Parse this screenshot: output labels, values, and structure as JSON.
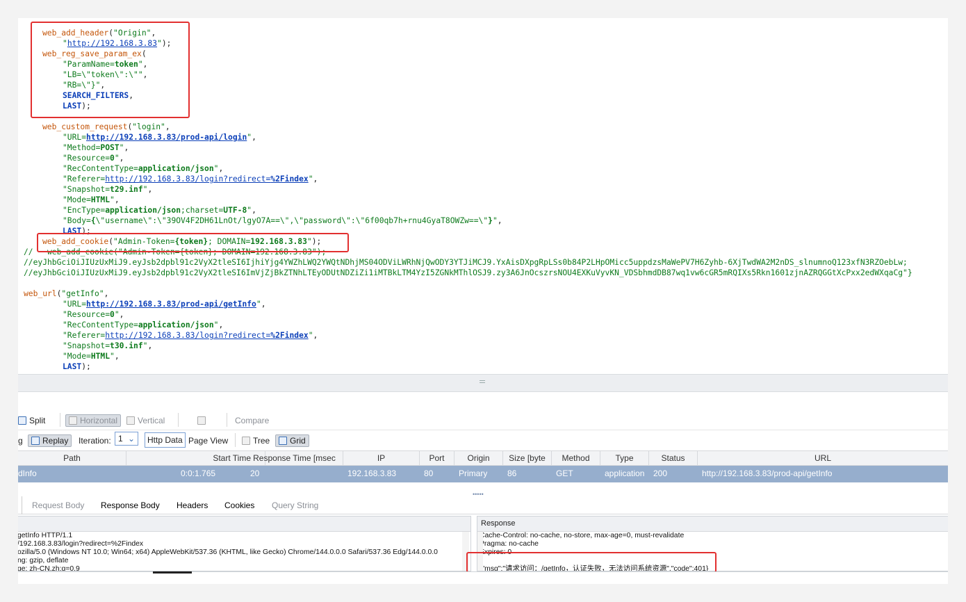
{
  "code_lines": [
    {
      "indent": "i1",
      "html": "<span class='fn'>web_add_header</span>(<span class='str'>\"Origin\"</span>,"
    },
    {
      "indent": "i2",
      "html": "<span class='str'>\"</span><span class='urlp'>http://192.168.3.83</span><span class='str'>\"</span>);"
    },
    {
      "indent": "i1",
      "html": "<span class='fn'>web_reg_save_param_ex</span>("
    },
    {
      "indent": "i2",
      "html": "<span class='str'>\"ParamName=</span><span class='grn'>token</span><span class='str'>\"</span>,"
    },
    {
      "indent": "i2",
      "html": "<span class='str'>\"LB=\\\"token\\\":\\\"\"</span>,"
    },
    {
      "indent": "i2",
      "html": "<span class='str'>\"RB=\\\"}\"</span>,"
    },
    {
      "indent": "i2",
      "html": "<span class='kw'>SEARCH_FILTERS</span>,"
    },
    {
      "indent": "i2",
      "html": "<span class='kw'>LAST</span>);"
    },
    {
      "indent": "i1",
      "html": ""
    },
    {
      "indent": "i1",
      "html": "<span class='fn'>web_custom_request</span>(<span class='str'>\"login\"</span>,"
    },
    {
      "indent": "i2",
      "html": "<span class='str'>\"URL=</span><span class='url'>http://192.168.3.83/prod-api/login</span><span class='str'>\"</span>,"
    },
    {
      "indent": "i2",
      "html": "<span class='str'>\"Method=</span><span class='grn'>POST</span><span class='str'>\"</span>,"
    },
    {
      "indent": "i2",
      "html": "<span class='str'>\"Resource=</span><span class='grn'>0</span><span class='str'>\"</span>,"
    },
    {
      "indent": "i2",
      "html": "<span class='str'>\"RecContentType=</span><span class='grn'>application/json</span><span class='str'>\"</span>,"
    },
    {
      "indent": "i2",
      "html": "<span class='str'>\"Referer=</span><span class='urlp'>http://192.168.3.83/login?redirect=</span><span class='url'>%2Findex</span><span class='str'>\"</span>,"
    },
    {
      "indent": "i2",
      "html": "<span class='str'>\"Snapshot=</span><span class='grn'>t29.inf</span><span class='str'>\"</span>,"
    },
    {
      "indent": "i2",
      "html": "<span class='str'>\"Mode=</span><span class='grn'>HTML</span><span class='str'>\"</span>,"
    },
    {
      "indent": "i2",
      "html": "<span class='str'>\"EncType=</span><span class='grn'>application/json</span><span class='str'>;charset=</span><span class='grn'>UTF-8</span><span class='str'>\"</span>,"
    },
    {
      "indent": "i2",
      "html": "<span class='str'>\"Body=</span><span class='grn'>{</span><span class='str'>\\\"username\\\":\\\"39OV4F2DH61LnOt/lgyO7A==\\\",\\\"password\\\":\\\"6f00qb7h+rnu4GyaT8OWZw==\\\"</span><span class='grn'>}</span><span class='str'>\"</span>,"
    },
    {
      "indent": "i2",
      "html": "<span class='kw'>LAST</span>);"
    },
    {
      "indent": "i1",
      "html": "<span class='fn'>web_add_cookie</span>(<span class='str'>\"Admin-Token=</span><span class='grn'>{token}</span><span class='str'>; DOMAIN=</span><span class='grn'>192.168.3.83</span><span class='str'>\"</span>);"
    },
    {
      "indent": "i0",
      "html": "<span class='cmt'>//   web_add_cookie(\"Admin-Token={token}; DOMAIN=192.168.3.83\");</span>"
    },
    {
      "indent": "i0",
      "html": "<span class='cmt'>//eyJhbGciOiJIUzUxMiJ9.eyJsb2dpbl91c2VyX2tleSI6IjhiYjg4YWZhLWQ2YWQtNDhjMS04ODViLWRhNjQwODY3YTJiMCJ9.YxAisDXpgRpLSs0b84P2LHpOMicc5uppdzsMaWePV7H6Zyhb-6XjTwdWA2M2nDS_slnumnoQ123xfN3RZOebLw;</span>"
    },
    {
      "indent": "i0",
      "html": "<span class='cmt'>//eyJhbGciOiJIUzUxMiJ9.eyJsb2dpbl91c2VyX2tleSI6ImVjZjBkZTNhLTEyODUtNDZiZi1iMTBkLTM4YzI5ZGNkMThlOSJ9.zy3A6JnOcszrsNOU4EXKuVyvKN_VDSbhmdDB87wq1vw6cGR5mRQIXs5Rkn1601zjnAZRQGGtXcPxx2edWXqaCg\"}</span>"
    },
    {
      "indent": "i0",
      "html": ""
    },
    {
      "indent": "i0",
      "html": "<span class='fn'>web_url</span>(<span class='str'>\"getInfo\"</span>,"
    },
    {
      "indent": "i2",
      "html": "<span class='str'>\"URL=</span><span class='url'>http://192.168.3.83/prod-api/getInfo</span><span class='str'>\"</span>,"
    },
    {
      "indent": "i2",
      "html": "<span class='str'>\"Resource=</span><span class='grn'>0</span><span class='str'>\"</span>,"
    },
    {
      "indent": "i2",
      "html": "<span class='str'>\"RecContentType=</span><span class='grn'>application/json</span><span class='str'>\"</span>,"
    },
    {
      "indent": "i2",
      "html": "<span class='str'>\"Referer=</span><span class='urlp'>http://192.168.3.83/login?redirect=</span><span class='url'>%2Findex</span><span class='str'>\"</span>,"
    },
    {
      "indent": "i2",
      "html": "<span class='str'>\"Snapshot=</span><span class='grn'>t30.inf</span><span class='str'>\"</span>,"
    },
    {
      "indent": "i2",
      "html": "<span class='str'>\"Mode=</span><span class='grn'>HTML</span><span class='str'>\"</span>,"
    },
    {
      "indent": "i2",
      "html": "<span class='kw'>LAST</span>);"
    }
  ],
  "toolbar1": {
    "split": "Split",
    "horizontal": "Horizontal",
    "vertical": "Vertical",
    "compare": "Compare"
  },
  "toolbar2": {
    "g_fragment": "g",
    "replay": "Replay",
    "iteration_label": "Iteration:",
    "iteration_value": "1",
    "http_data": "Http Data",
    "page_view": "Page View",
    "tree": "Tree",
    "grid": "Grid"
  },
  "grid": {
    "columns": [
      "Path",
      "Start Time",
      "Response Time [msec",
      "IP",
      "Port",
      "Origin",
      "Size [byte",
      "Method",
      "Type",
      "Status",
      "URL"
    ],
    "row": [
      "dInfo",
      "0:0:1.765",
      "20",
      "192.168.3.83",
      "80",
      "Primary",
      "86",
      "GET",
      "application",
      "200",
      "http://192.168.3.83/prod-api/getInfo"
    ]
  },
  "tabs": [
    "Request Body",
    "Response Body",
    "Headers",
    "Cookies",
    "Query String"
  ],
  "request_panel": {
    "lines": [
      "getInfo HTTP/1.1",
      "/192.168.3.83/login?redirect=%2Findex",
      "ozilla/5.0 (Windows NT 10.0; Win64; x64) AppleWebKit/537.36 (KHTML, like Gecko) Chrome/144.0.0.0 Safari/537.36 Edg/144.0.0.0",
      "ng: gzip, deflate",
      "ge: zh-CN,zh;q=0.9"
    ]
  },
  "response_panel": {
    "title": "Response",
    "lines": [
      "Cache-Control: no-cache, no-store, max-age=0, must-revalidate",
      "Pragma: no-cache",
      "Expires: 0",
      "",
      "{\"msg\":\"请求访问：/getInfo，认证失败，无法访问系统资源\",\"code\":401}"
    ]
  }
}
